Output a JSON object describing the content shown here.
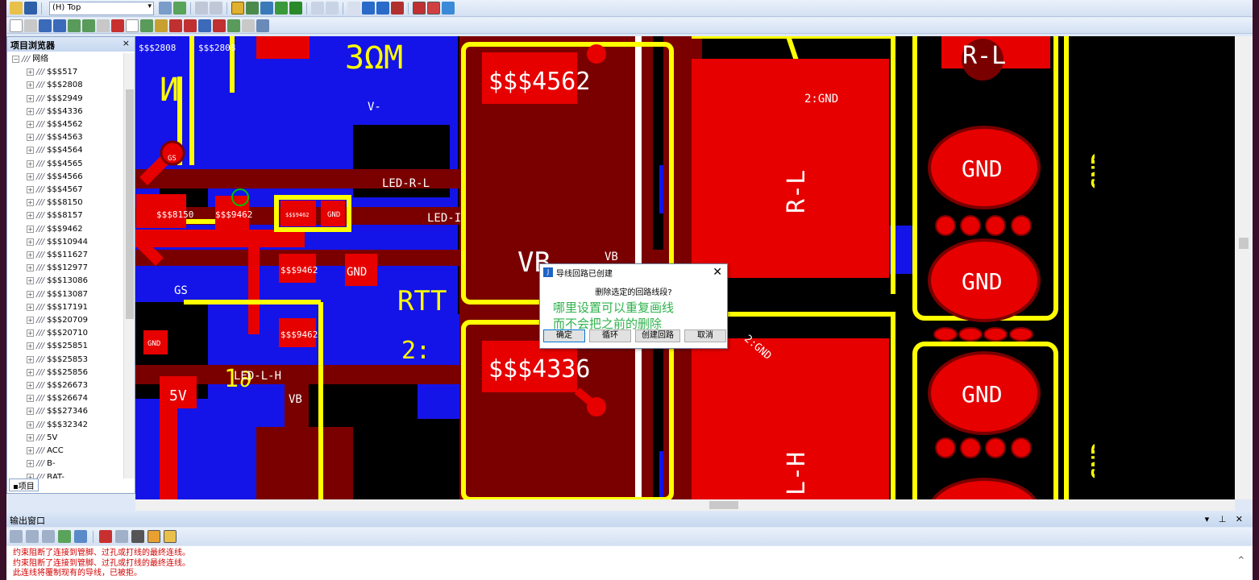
{
  "toolbar": {
    "layer_select": "(H) Top"
  },
  "project_browser": {
    "title": "项目浏览器",
    "root": "网络",
    "nets": [
      "$$$517",
      "$$$2808",
      "$$$2949",
      "$$$4336",
      "$$$4562",
      "$$$4563",
      "$$$4564",
      "$$$4565",
      "$$$4566",
      "$$$4567",
      "$$$8150",
      "$$$8157",
      "$$$9462",
      "$$$10944",
      "$$$11627",
      "$$$12977",
      "$$$13086",
      "$$$13087",
      "$$$17191",
      "$$$20709",
      "$$$20710",
      "$$$25851",
      "$$$25853",
      "$$$25856",
      "$$$26673",
      "$$$26674",
      "$$$27346",
      "$$$32342",
      "5V",
      "ACC",
      "B-",
      "BAT-"
    ],
    "tab": "项目"
  },
  "canvas_labels": {
    "n4562": "$$$4562",
    "n4336": "$$$4336",
    "n2808a": "$$$2808",
    "n2808b": "$$$2808",
    "n8150": "$$$8150",
    "n9462a": "$$$9462",
    "n9462b": "$$$9462",
    "n9462c": "$$$9462",
    "n9462d": "$$$9462",
    "gnd": "GND",
    "two_gnd": "2:GND",
    "vminus": "V-",
    "vb": "VB",
    "gs": "GS",
    "five_v": "5V",
    "led_r_l": "LED-R-L",
    "led_l_h": "LED-L-H",
    "led_i": "LED-I",
    "r_l": "R-L",
    "l_h": "L-H"
  },
  "dialog": {
    "title": "导线回路已创建",
    "message": "删除选定的回路线段?",
    "note_line1": "哪里设置可以重复画线",
    "note_line2": "而不会把之前的删除",
    "buttons": [
      "确定",
      "循环",
      "创建回路",
      "取消"
    ]
  },
  "output": {
    "title": "输出窗口",
    "lines": [
      "约束阻断了连接到管脚、过孔或打线的最终连线。",
      "约束阻断了连接到管脚、过孔或打线的最终连线。",
      "此连线将覆制现有的导线，已被拒。"
    ]
  }
}
